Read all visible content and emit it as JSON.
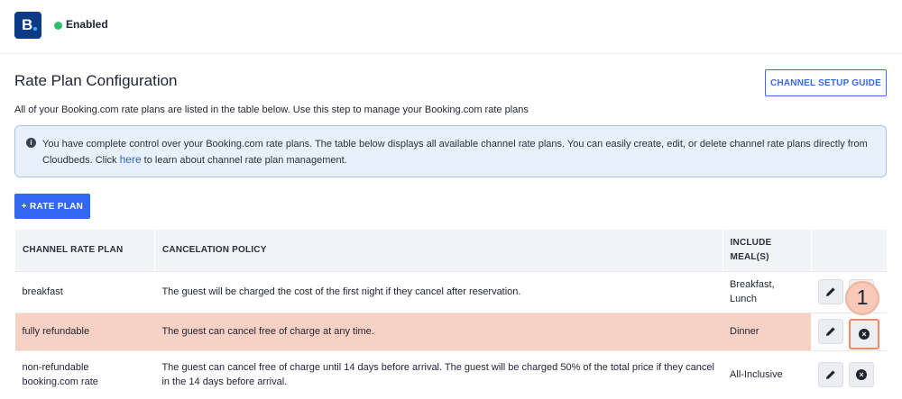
{
  "header": {
    "logo_letter": "B",
    "status": "Enabled"
  },
  "page": {
    "title": "Rate Plan Configuration",
    "guide_button": "CHANNEL SETUP GUIDE",
    "intro": "All of your Booking.com rate plans are listed in the table below. Use this step to manage your Booking.com rate plans"
  },
  "info": {
    "text_before": "You have complete control over your Booking.com rate plans. The table below displays all available channel rate plans. You can easily create, edit, or delete channel rate plans directly from Cloudbeds. Click ",
    "link": "here",
    "text_after": " to learn about channel rate plan management."
  },
  "add_button": "+ RATE PLAN",
  "table": {
    "headers": [
      "CHANNEL RATE PLAN",
      "CANCELATION POLICY",
      "INCLUDE MEAL(S)",
      ""
    ],
    "rows": [
      {
        "plan": "breakfast",
        "policy": "The guest will be charged the cost of the first night if they cancel after reservation.",
        "meals": "Breakfast, Lunch"
      },
      {
        "plan": "fully refundable",
        "policy": "The guest can cancel free of charge at any time.",
        "meals": "Dinner"
      },
      {
        "plan": "non-refundable booking.com rate",
        "policy": "The guest can cancel free of charge until 14 days before arrival. The guest will be charged 50% of the total price if they cancel in the 14 days before arrival.",
        "meals": "All-Inclusive"
      }
    ]
  },
  "annotation": {
    "step": "1"
  },
  "colors": {
    "primary": "#3366f1",
    "highlight_row": "#f8d1c5",
    "status_green": "#2fbe6b",
    "logo_bg": "#0b3a86"
  },
  "icons": [
    "info-icon",
    "pencil-icon",
    "x-circle-icon"
  ]
}
